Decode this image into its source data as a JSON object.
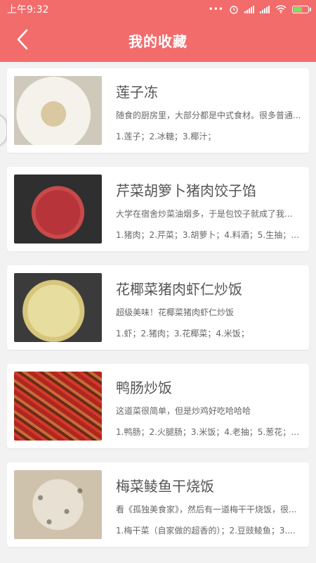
{
  "status_bar": {
    "time": "上午9:32",
    "network": "•••"
  },
  "header": {
    "title": "我的收藏"
  },
  "colors": {
    "accent": "#f26c6c",
    "background": "#f2f2f2"
  },
  "icons": {
    "back": "chevron-left-icon"
  },
  "favorites": [
    {
      "title": "莲子冻",
      "desc": "随食的厨房里，大部分都是中式食材。很多普通...",
      "ingredients": "1.莲子；2.冰糖；3.椰汁；"
    },
    {
      "title": "芹菜胡箩卜猪肉饺子馅",
      "desc": "大学在宿舍炒菜油烟多，于是包饺子就成了我...",
      "ingredients": "1.猪肉；2.芹菜；3.胡萝卜；4.料酒；5.生抽；6...."
    },
    {
      "title": "花椰菜猪肉虾仁炒饭",
      "desc": "超级美味！花椰菜猪肉虾仁炒饭",
      "ingredients": "1.虾；2.猪肉；3.花椰菜；4.米饭；"
    },
    {
      "title": "鸭肠炒饭",
      "desc": "这道菜很简单，但是炒鸡好吃哈哈哈",
      "ingredients": "1.鸭肠；2.火腿肠；3.米饭；4.老抽；5.葱花；6...."
    },
    {
      "title": "梅菜鲮鱼干烧饭",
      "desc": "看《孤独美食家》，然后有一道梅干干烧饭，很...",
      "ingredients": "1.梅干菜（自家做的超香的）；2.豆豉鲮鱼；3...."
    }
  ]
}
